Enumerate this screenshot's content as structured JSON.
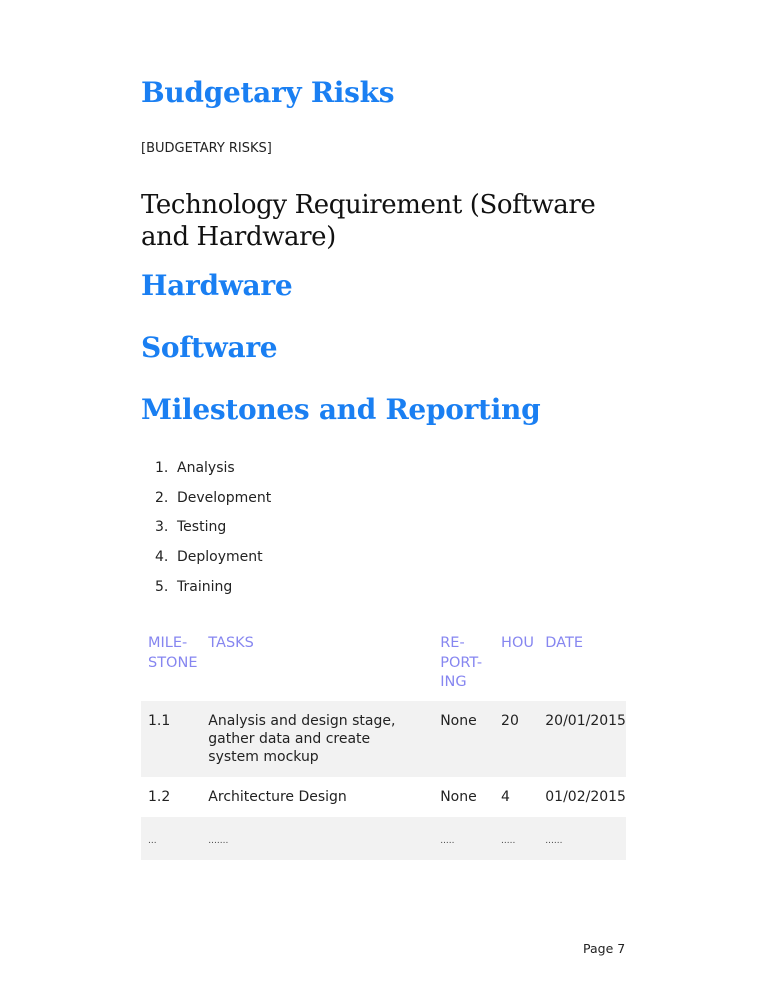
{
  "document": {
    "sections": {
      "budgetary_risks": {
        "heading": "Budgetary Risks",
        "placeholder": "[BUDGETARY RISKS]"
      },
      "technology_requirement": {
        "heading": "Technology Requirement (Software and Hardware)"
      },
      "hardware": {
        "heading": "Hardware"
      },
      "software": {
        "heading": "Software"
      },
      "milestones": {
        "heading": "Milestones and Reporting",
        "steps": [
          {
            "number": "1.",
            "label": "Analysis"
          },
          {
            "number": "2.",
            "label": "Development"
          },
          {
            "number": "3.",
            "label": "Testing"
          },
          {
            "number": "4.",
            "label": "Deployment"
          },
          {
            "number": "5.",
            "label": "Training"
          }
        ],
        "table": {
          "headers": [
            "MILE-STONE",
            "TASKS",
            "RE-PORT-ING",
            "HOU",
            "DATE"
          ],
          "headers_display": [
            "MILE-\nSTONE",
            "TASKS",
            "RE-\nPORT-\nING",
            "HOU",
            "DATE"
          ],
          "rows": [
            [
              "1.1",
              "Analysis and design stage, gather data and create system mockup",
              "None",
              "20",
              "20/01/2015"
            ],
            [
              "1.2",
              "Architecture Design",
              "None",
              "4",
              "01/02/2015"
            ],
            [
              "...",
              ".......",
              ".....",
              ".....",
              "......"
            ]
          ]
        }
      }
    },
    "footer": {
      "page_label": "Page 7"
    }
  },
  "colors": {
    "heading_blue": "#1a7ff2",
    "table_header_purple": "#8686f0",
    "row_shade": "#f2f2f2"
  }
}
